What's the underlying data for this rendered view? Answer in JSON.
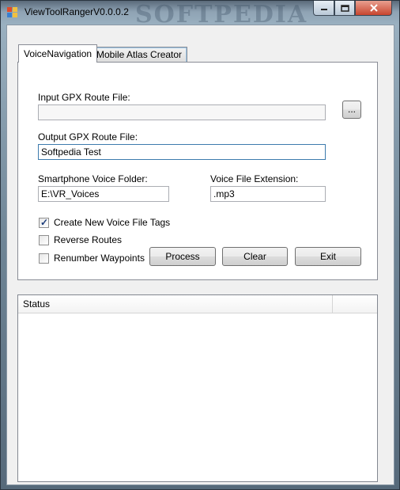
{
  "window": {
    "title": "ViewToolRangerV0.0.0.2",
    "watermark": "SOFTPEDIA"
  },
  "tabs": [
    {
      "label": "VoiceNavigation"
    },
    {
      "label": "Mobile Atlas Creator"
    }
  ],
  "form": {
    "input_gpx_label": "Input GPX Route File:",
    "input_gpx_value": "",
    "browse_label": "...",
    "output_gpx_label": "Output GPX Route File:",
    "output_gpx_value": "Softpedia Test",
    "voice_folder_label": "Smartphone Voice Folder:",
    "voice_folder_value": "E:\\VR_Voices",
    "voice_ext_label": "Voice File Extension:",
    "voice_ext_value": ".mp3"
  },
  "options": [
    {
      "label": "Create New Voice File Tags",
      "checked": true
    },
    {
      "label": "Reverse Routes",
      "checked": false
    },
    {
      "label": "Renumber Waypoints",
      "checked": false
    }
  ],
  "buttons": {
    "process": "Process",
    "clear": "Clear",
    "exit": "Exit"
  },
  "status": {
    "column": "Status"
  }
}
